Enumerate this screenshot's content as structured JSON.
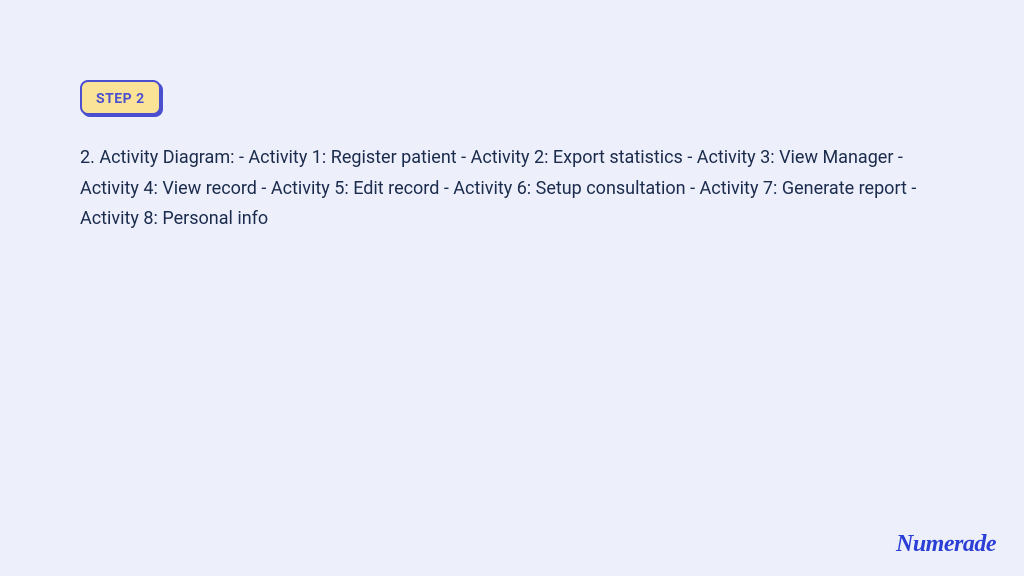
{
  "step": {
    "label": "STEP 2"
  },
  "content": {
    "text": "2. Activity Diagram: - Activity 1: Register patient - Activity 2: Export statistics - Activity 3: View Manager - Activity 4: View record - Activity 5: Edit record - Activity 6: Setup consultation - Activity 7: Generate report - Activity 8: Personal info"
  },
  "brand": {
    "name": "Numerade"
  }
}
